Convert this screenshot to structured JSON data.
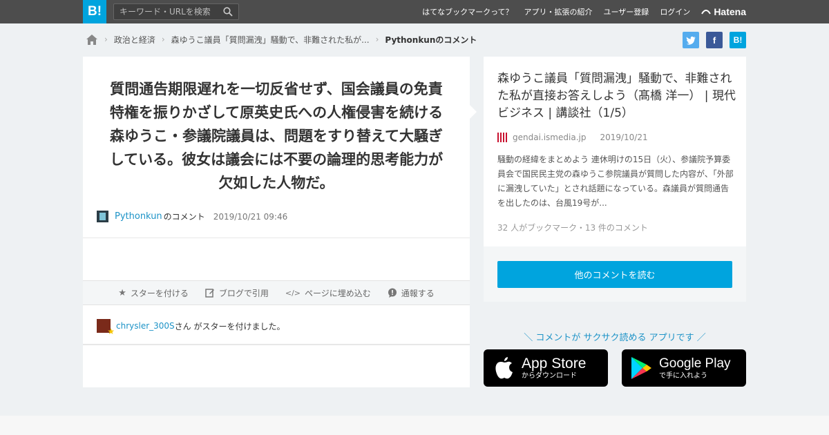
{
  "topbar": {
    "logo": "B!",
    "search_placeholder": "キーワード・URLを検索",
    "nav": [
      "はてなブックマークって？",
      "アプリ・拡張の紹介",
      "ユーザー登録",
      "ログイン"
    ],
    "brand": "Hatena"
  },
  "breadcrumb": {
    "items": [
      "政治と経済",
      "森ゆうこ議員「質問漏洩」騒動で、非難された私が...",
      "Pythonkunのコメント"
    ]
  },
  "share": {
    "twitter": "t",
    "facebook": "f",
    "hatena": "B!"
  },
  "comment": {
    "text": "質問通告期限遅れを一切反省せず、国会議員の免責特権を振りかざして原英史氏への人権侵害を続ける森ゆうこ・参議院議員は、問題をすり替えて大騒ぎしている。彼女は議会には不要の論理的思考能力が欠如した人物だ。",
    "user": "Pythonkun",
    "user_suffix": "のコメント",
    "timestamp": "2019/10/21 09:46"
  },
  "actions": {
    "star": "スターを付ける",
    "blog": "ブログで引用",
    "embed": "ページに埋め込む",
    "report": "通報する"
  },
  "star_notice": {
    "user": "chrysler_300S",
    "text": "さん がスターを付けました。"
  },
  "entry": {
    "title": "森ゆうこ議員「質問漏洩」騒動で、非難された私が直接お答えしよう（髙橋 洋一） | 現代ビジネス | 講談社（1/5）",
    "domain": "gendai.ismedia.jp",
    "date": "2019/10/21",
    "summary": "騒動の経緯をまとめよう 連休明けの15日（火）、参議院予算委員会で国民民主党の森ゆうこ参院議員が質問した内容が、「外部に漏洩していた」とされ話題になっている。森議員が質問通告を出したのは、台風19号が...",
    "count": "32 人がブックマーク・13 件のコメント",
    "more_button": "他のコメントを読む"
  },
  "promo": {
    "tagline": "＼ コメントが サクサク読める アプリです ／",
    "appstore_big": "App Store",
    "appstore_small": "からダウンロード",
    "googleplay_big": "Google Play",
    "googleplay_small": "で手に入れよう"
  },
  "colors": {
    "accent": "#00a4de",
    "topbar": "#4d4d4d",
    "twitter": "#55acee",
    "facebook": "#3b5998"
  }
}
